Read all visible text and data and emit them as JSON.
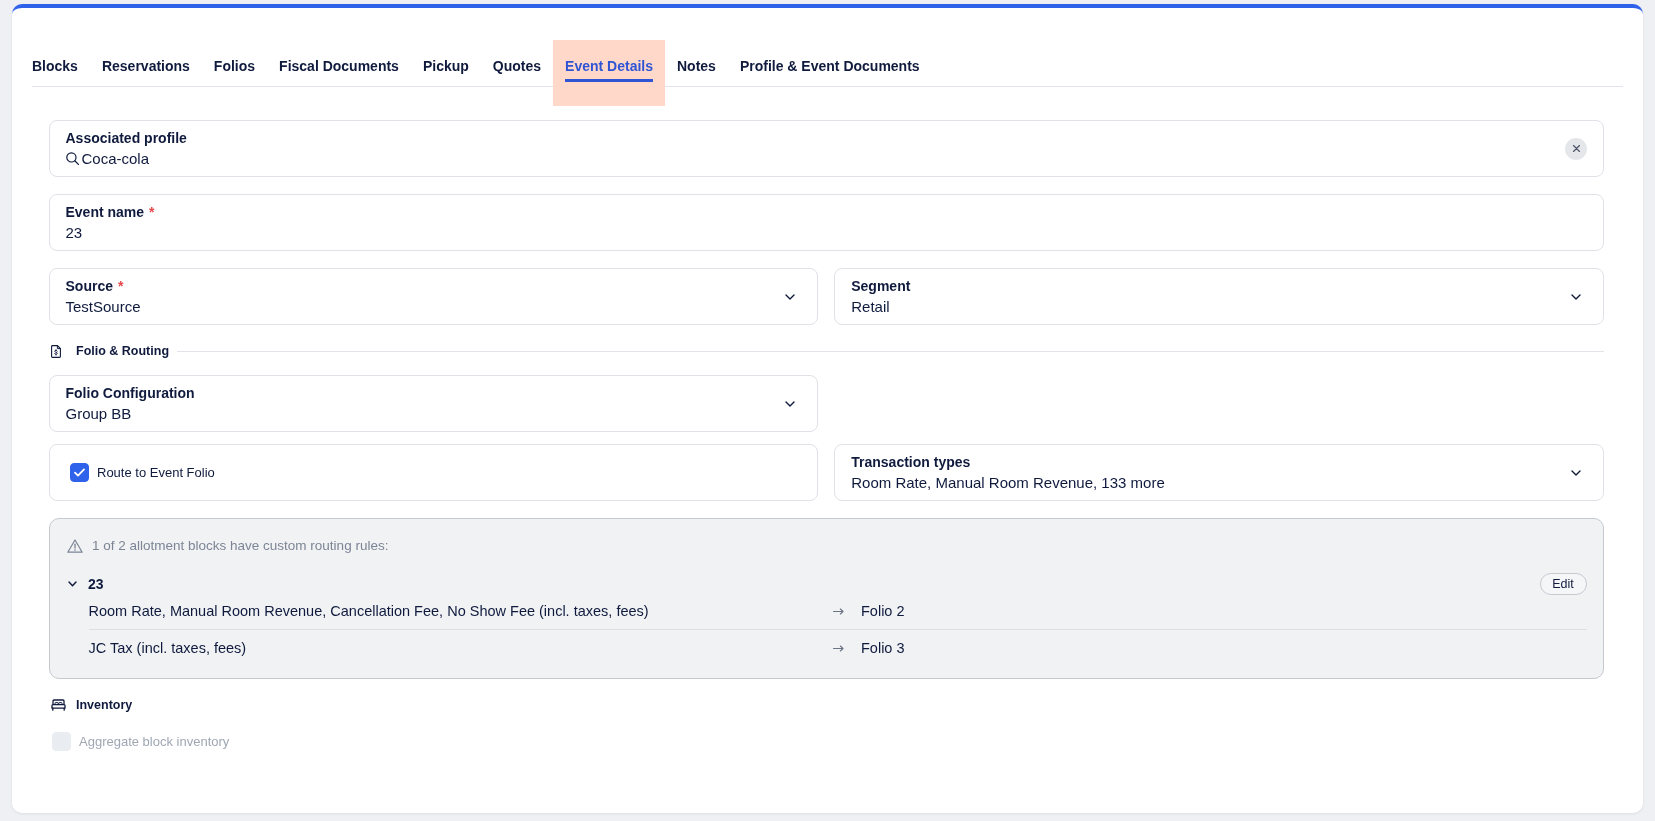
{
  "tabs": [
    {
      "label": "Blocks",
      "selected": false
    },
    {
      "label": "Reservations",
      "selected": false
    },
    {
      "label": "Folios",
      "selected": false
    },
    {
      "label": "Fiscal Documents",
      "selected": false
    },
    {
      "label": "Pickup",
      "selected": false
    },
    {
      "label": "Quotes",
      "selected": false
    },
    {
      "label": "Event Details",
      "selected": true
    },
    {
      "label": "Notes",
      "selected": false
    },
    {
      "label": "Profile & Event Documents",
      "selected": false
    }
  ],
  "event": {
    "associated_profile": {
      "label": "Associated profile",
      "value": "Coca-cola"
    },
    "event_name": {
      "label": "Event name",
      "required_mark": "*",
      "value": "23"
    },
    "source": {
      "label": "Source",
      "required_mark": "*",
      "value": "TestSource"
    },
    "segment": {
      "label": "Segment",
      "value": "Retail"
    }
  },
  "folio_routing": {
    "title": "Folio & Routing",
    "folio_configuration": {
      "label": "Folio Configuration",
      "value": "Group BB"
    },
    "route_to_event_folio": {
      "label": "Route to Event Folio",
      "checked": true
    },
    "transaction_types": {
      "label": "Transaction types",
      "value": "Room Rate, Manual Room Revenue, 133 more"
    },
    "routing_notice": {
      "message": "1 of 2 allotment blocks have custom routing rules:",
      "blocks": [
        {
          "name": "23",
          "expanded": true,
          "action": "Edit",
          "rules": [
            {
              "charges": "Room Rate, Manual Room Revenue, Cancellation Fee, No Show Fee (incl. taxes, fees)",
              "target": "Folio 2"
            },
            {
              "charges": "JC Tax (incl. taxes, fees)",
              "target": "Folio 3"
            }
          ]
        }
      ]
    }
  },
  "inventory": {
    "title": "Inventory",
    "aggregate_block_inventory": {
      "label": "Aggregate block inventory",
      "checked": false,
      "disabled": true
    }
  }
}
